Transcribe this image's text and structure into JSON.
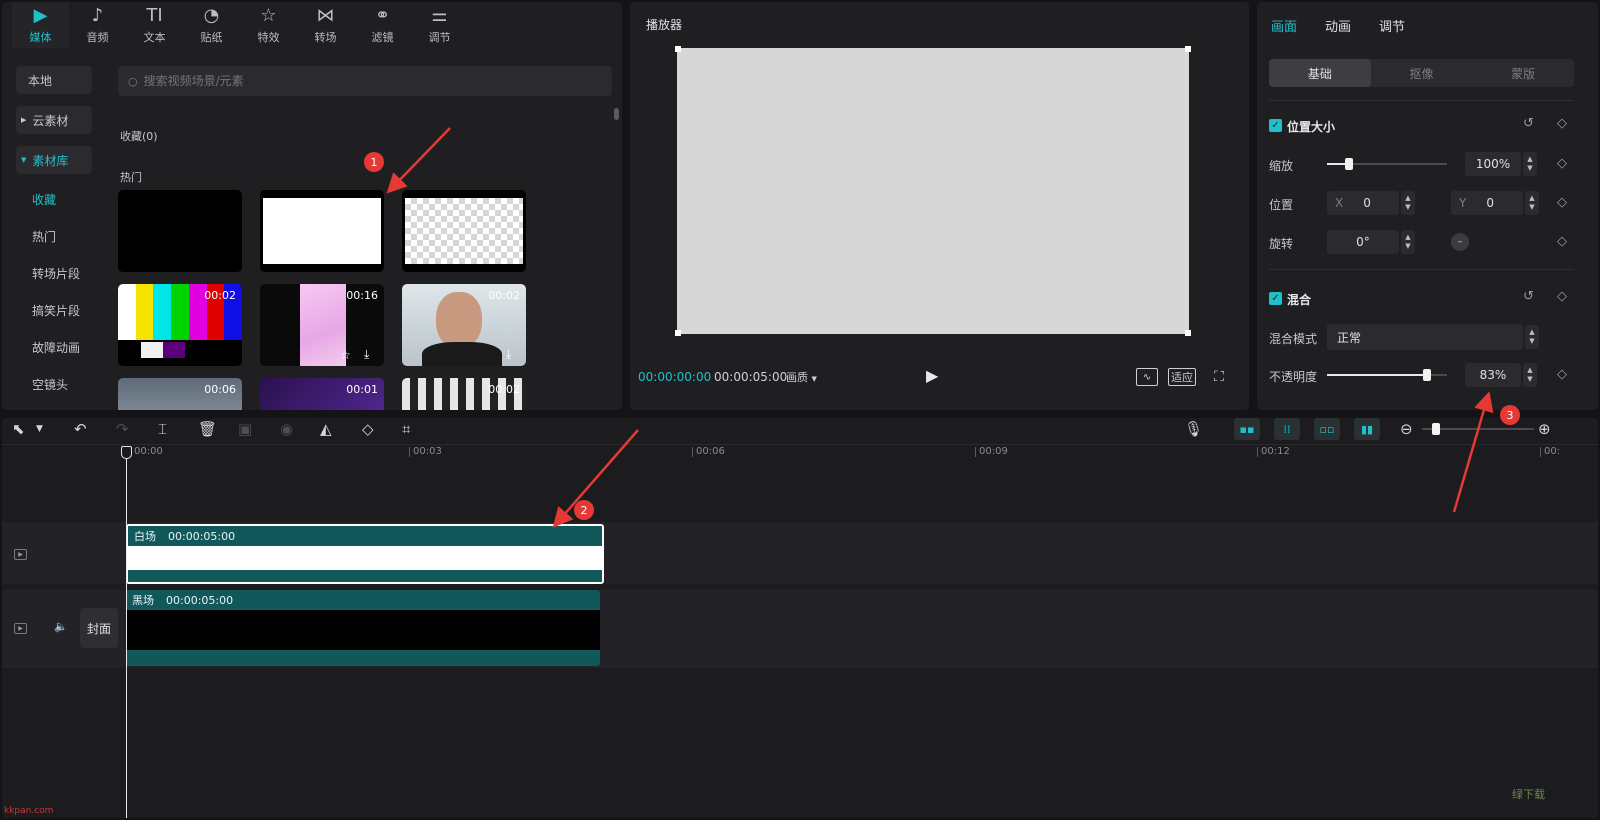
{
  "media": {
    "tabs": [
      {
        "label": "媒体",
        "icon": "▶",
        "icon_name": "media-icon"
      },
      {
        "label": "音频",
        "icon": "♪",
        "icon_name": "audio-icon"
      },
      {
        "label": "文本",
        "icon": "TI",
        "icon_name": "text-icon"
      },
      {
        "label": "贴纸",
        "icon": "◔",
        "icon_name": "sticker-icon"
      },
      {
        "label": "特效",
        "icon": "☆",
        "icon_name": "effects-icon"
      },
      {
        "label": "转场",
        "icon": "⋈",
        "icon_name": "transition-icon"
      },
      {
        "label": "滤镜",
        "icon": "⚭",
        "icon_name": "filter-icon"
      },
      {
        "label": "调节",
        "icon": "⚌",
        "icon_name": "adjust-icon"
      }
    ],
    "sidebar": {
      "local": "本地",
      "cloud": "云素材",
      "library": "素材库",
      "sub_items": [
        "收藏",
        "热门",
        "转场片段",
        "搞笑片段",
        "故障动画",
        "空镜头"
      ]
    },
    "search_placeholder": "搜索视频场景/元素",
    "favorites_label": "收藏(0)",
    "hot_label": "热门",
    "thumbnails": [
      {
        "duration": ""
      },
      {
        "duration": ""
      },
      {
        "duration": ""
      },
      {
        "duration": "00:02"
      },
      {
        "duration": "00:16"
      },
      {
        "duration": "00:02"
      },
      {
        "duration": "00:06"
      },
      {
        "duration": "00:01"
      },
      {
        "duration": "00:02"
      }
    ],
    "test_bar_colors": [
      "#ffffff",
      "#f4e400",
      "#00e5e5",
      "#00d400",
      "#e000e0",
      "#e00000",
      "#1010e6"
    ]
  },
  "player": {
    "title": "播放器",
    "current_time": "00:00:00:00",
    "total_time": "00:00:05:00",
    "quality": "画质",
    "fit_label": "适应"
  },
  "props": {
    "tabs": [
      "画面",
      "动画",
      "调节"
    ],
    "segments": [
      "基础",
      "抠像",
      "蒙版"
    ],
    "position_size": {
      "title": "位置大小",
      "scale_label": "缩放",
      "scale_value": "100%",
      "scale_fraction": 0.18,
      "position_label": "位置",
      "x_label": "X",
      "x_value": "0",
      "y_label": "Y",
      "y_value": "0",
      "rotation_label": "旋转",
      "rotation_value": "0°"
    },
    "blend": {
      "title": "混合",
      "mode_label": "混合模式",
      "mode_value": "正常",
      "opacity_label": "不透明度",
      "opacity_value": "83%",
      "opacity_fraction": 0.83
    }
  },
  "timeline": {
    "ticks": [
      "00:00",
      "00:03",
      "00:06",
      "00:09",
      "00:12",
      "00:"
    ],
    "clips": [
      {
        "name": "白场",
        "duration": "00:00:05:00",
        "color": "#ffffff"
      },
      {
        "name": "黑场",
        "duration": "00:00:05:00",
        "color": "#000000"
      }
    ],
    "cover_label": "封面"
  },
  "annotations": [
    "1",
    "2",
    "3"
  ],
  "watermark": {
    "site": "kkpan.com",
    "logo_text": "绿下载"
  },
  "colors": {
    "accent": "#21c0c9",
    "clip": "#11585a",
    "marker": "#e53935"
  }
}
